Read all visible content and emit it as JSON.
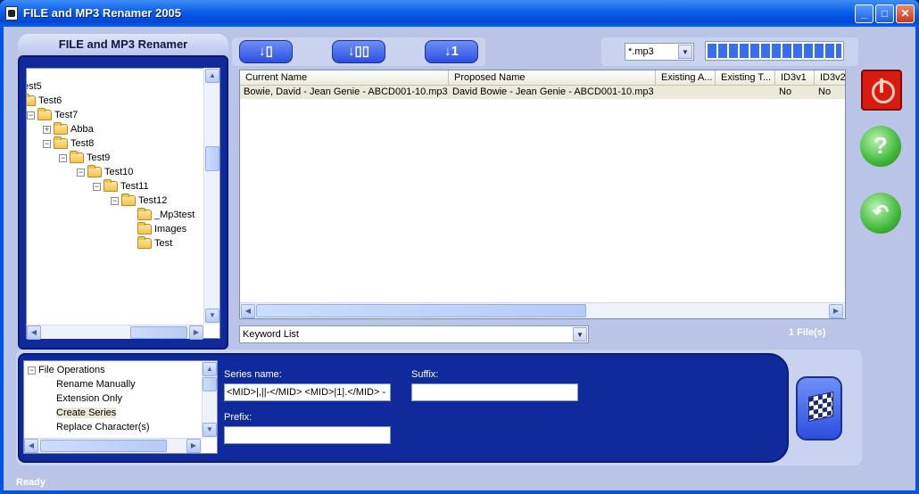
{
  "window": {
    "title": "FILE and MP3 Renamer 2005",
    "minimize": "_",
    "maximize": "□",
    "close": "✕"
  },
  "left_panel": {
    "title": "FILE and MP3 Renamer",
    "tree": [
      {
        "label": "·",
        "expander": "",
        "folder": false
      },
      {
        "label": "est5",
        "expander": "",
        "folder": false
      },
      {
        "label": "Test6",
        "expander": "",
        "folder": true
      },
      {
        "label": "Test7",
        "expander": "-",
        "folder": true
      },
      {
        "label": "Abba",
        "expander": "+",
        "folder": true
      },
      {
        "label": "Test8",
        "expander": "-",
        "folder": true
      },
      {
        "label": "Test9",
        "expander": "-",
        "folder": true
      },
      {
        "label": "Test10",
        "expander": "-",
        "folder": true
      },
      {
        "label": "Test11",
        "expander": "-",
        "folder": true
      },
      {
        "label": "Test12",
        "expander": "-",
        "folder": true
      },
      {
        "label": "_Mp3test",
        "expander": "",
        "folder": true
      },
      {
        "label": "Images",
        "expander": "",
        "folder": true
      },
      {
        "label": "Test",
        "expander": "",
        "folder": true
      }
    ]
  },
  "toolbar": {
    "btn1_icon": "sort-down-file-icon",
    "btn2_icon": "sort-down-folders-icon",
    "btn3_icon": "sort-down-number-icon"
  },
  "filter": {
    "value": "*.mp3",
    "progress": 1.0
  },
  "file_list": {
    "columns": [
      "Current Name",
      "Proposed Name",
      "Existing A...",
      "Existing T...",
      "ID3v1",
      "ID3v2"
    ],
    "rows": [
      {
        "current": "Bowie, David - Jean Genie - ABCD001-10.mp3",
        "proposed": "David Bowie - Jean Genie - ABCD001-10.mp3",
        "existing_a": "",
        "existing_t": "",
        "id3v1": "No",
        "id3v2": "No"
      }
    ]
  },
  "keyword_list": {
    "value": "Keyword List"
  },
  "file_count": "1 File(s)",
  "operations": {
    "items": [
      {
        "label": "File Operations",
        "level": 0,
        "selected": false
      },
      {
        "label": "Rename Manually",
        "level": 1,
        "selected": false
      },
      {
        "label": "Extension Only",
        "level": 1,
        "selected": false
      },
      {
        "label": "Create Series",
        "level": 1,
        "selected": true
      },
      {
        "label": "Replace Character(s)",
        "level": 1,
        "selected": false
      }
    ]
  },
  "series": {
    "series_label": "Series name:",
    "series_value": "<MID>|,||-</MID> <MID>|1|.</MID> -",
    "suffix_label": "Suffix:",
    "suffix_value": "",
    "prefix_label": "Prefix:",
    "prefix_value": ""
  },
  "status": "Ready",
  "colors": {
    "title_bar": "#0a5fe8",
    "panel_blue": "#102a9c",
    "background": "#b9c4e6"
  }
}
